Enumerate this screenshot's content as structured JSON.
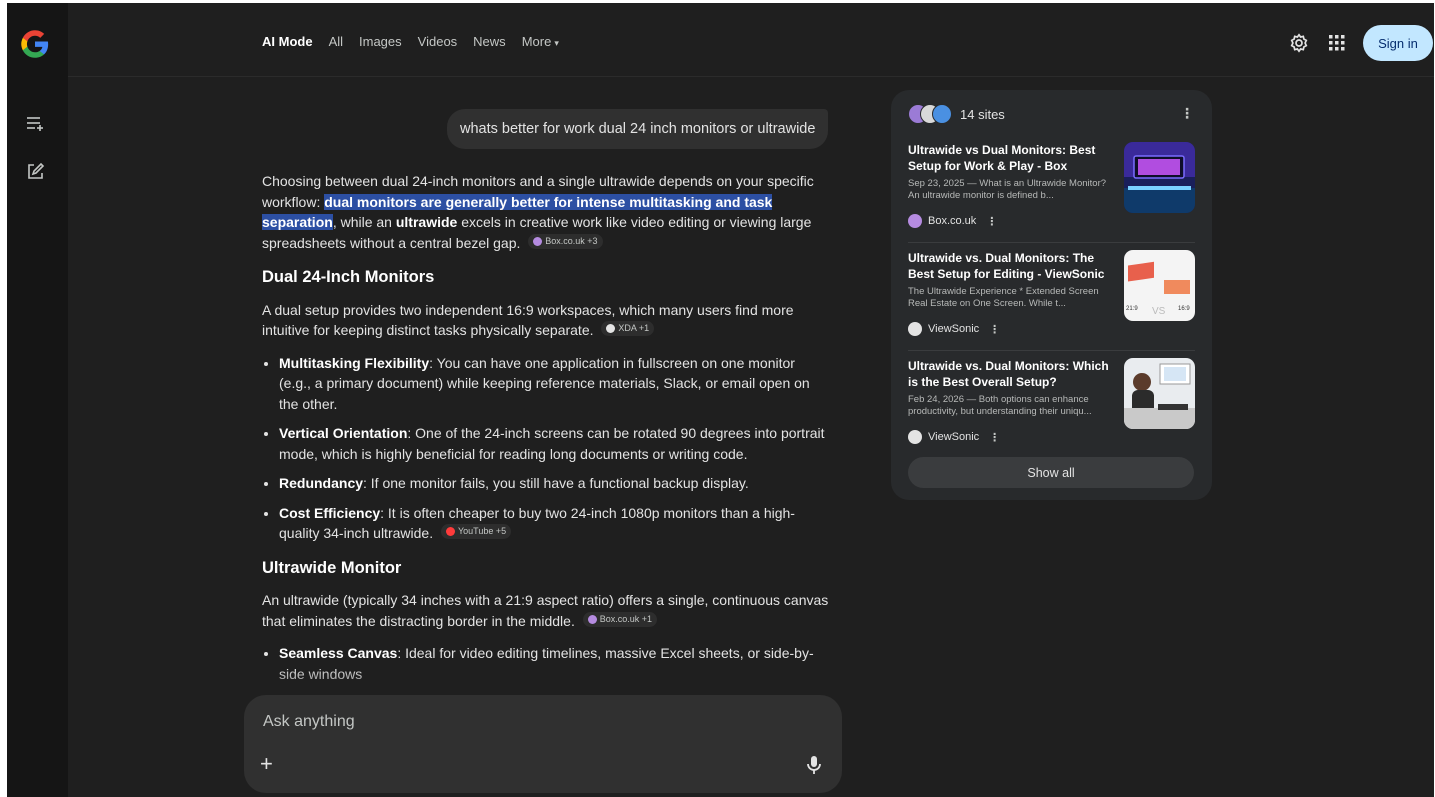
{
  "nav": {
    "tabs": [
      {
        "label": "AI Mode",
        "active": true
      },
      {
        "label": "All"
      },
      {
        "label": "Images"
      },
      {
        "label": "Videos"
      },
      {
        "label": "News"
      },
      {
        "label": "More"
      }
    ],
    "sign_in": "Sign in"
  },
  "rail": {
    "icons": [
      "g-logo",
      "history-icon",
      "new-chat-icon"
    ]
  },
  "query": "whats better for work dual 24 inch monitors or ultrawide",
  "answer": {
    "intro": {
      "t1": "Choosing between dual 24-inch monitors and a single ultrawide depends on your specific workflow: ",
      "highlight": "dual monitors are generally better for intense multitasking and task separation",
      "t2": ", while an ",
      "b1": "ultrawide",
      "t3": " excels in creative work like video editing or viewing large spreadsheets without a central bezel gap.",
      "chip": "Box.co.uk +3"
    },
    "section1": {
      "heading": "Dual 24-Inch Monitors",
      "para": "A dual setup provides two independent 16:9 workspaces, which many users find more intuitive for keeping distinct tasks physically separate.",
      "chip": "XDA +1",
      "bullets": [
        {
          "bold": "Multitasking Flexibility",
          "text": ": You can have one application in fullscreen on one monitor (e.g., a primary document) while keeping reference materials, Slack, or email open on the other."
        },
        {
          "bold": "Vertical Orientation",
          "text": ": One of the 24-inch screens can be rotated 90 degrees into portrait mode, which is highly beneficial for reading long documents or writing code."
        },
        {
          "bold": "Redundancy",
          "text": ": If one monitor fails, you still have a functional backup display."
        },
        {
          "bold": "Cost Efficiency",
          "text": ": It is often cheaper to buy two 24-inch 1080p monitors than a high-quality 34-inch ultrawide.",
          "chip": "YouTube +5"
        }
      ]
    },
    "section2": {
      "heading": "Ultrawide Monitor",
      "para": "An ultrawide (typically 34 inches with a 21:9 aspect ratio) offers a single, continuous canvas that eliminates the distracting border in the middle.",
      "chip": "Box.co.uk +1",
      "bullets": [
        {
          "bold": "Seamless Canvas",
          "text": ": Ideal for video editing timelines, massive Excel sheets, or side-by-side windows"
        }
      ]
    }
  },
  "composer": {
    "placeholder": "Ask anything"
  },
  "sources": {
    "count_label": "14 sites",
    "cards": [
      {
        "title": "Ultrawide vs Dual Monitors: Best Setup for Work & Play - Box",
        "snippet": "Sep 23, 2025 — What is an Ultrawide Monitor? An ultrawide monitor is defined b...",
        "source": "Box.co.uk"
      },
      {
        "title": "Ultrawide vs. Dual Monitors: The Best Setup for Editing - ViewSonic",
        "snippet": "The Ultrawide Experience * Extended Screen Real Estate on One Screen. While t...",
        "source": "ViewSonic",
        "thumb_text": {
          "left": "21:9",
          "vs": "VS",
          "right": "16:9"
        }
      },
      {
        "title": "Ultrawide vs. Dual Monitors: Which is the Best Overall Setup?",
        "snippet": "Feb 24, 2026 — Both options can enhance productivity, but understanding their uniqu...",
        "source": "ViewSonic"
      }
    ],
    "show_all": "Show all"
  },
  "colors": {
    "background": "#1f1f1f",
    "rail": "#151515",
    "highlight": "#2c4fa3",
    "sign_in_bg": "#c2e7ff",
    "panel": "#282a2c"
  }
}
